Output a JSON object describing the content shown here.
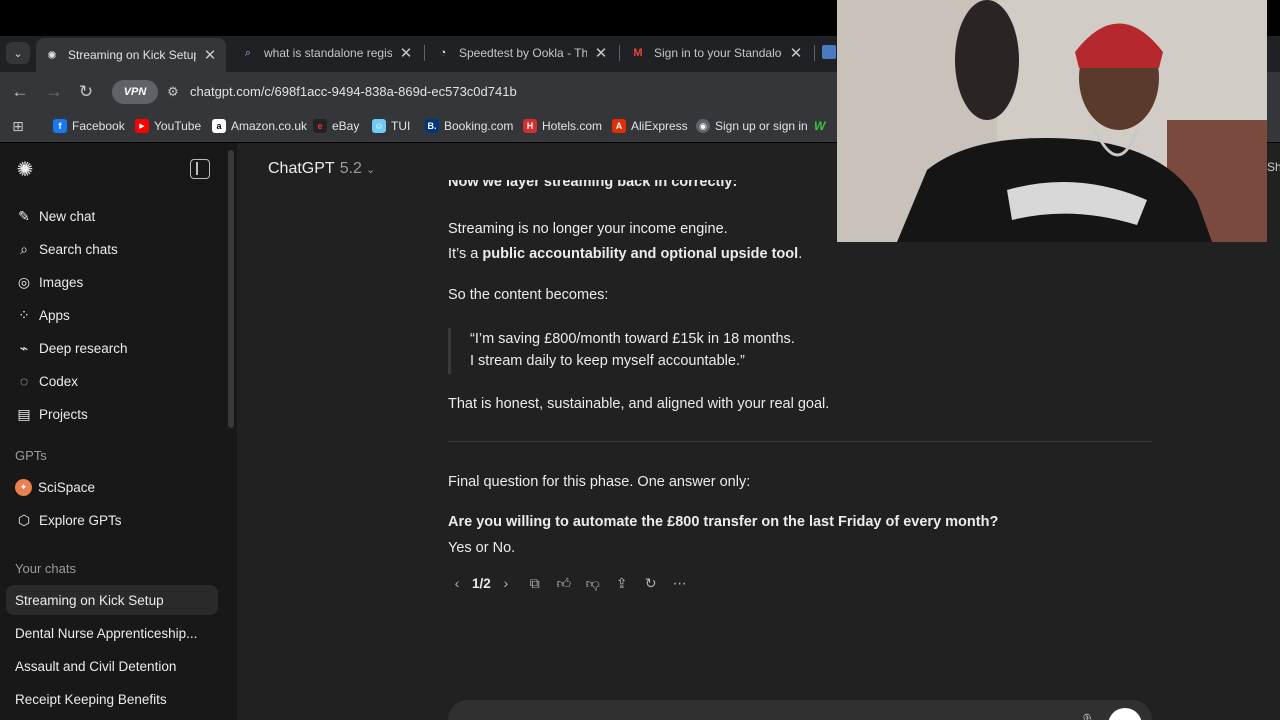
{
  "browser": {
    "tabs": [
      {
        "title": "Streaming on Kick Setup",
        "active": true,
        "icon": "chatgpt-icon"
      },
      {
        "title": "what is standalone registra",
        "active": false,
        "icon": "search-icon"
      },
      {
        "title": "Speedtest by Ookla - The G",
        "active": false,
        "icon": "speedtest-icon"
      },
      {
        "title": "Sign in to your Standalone",
        "active": false,
        "icon": "gmail-icon"
      }
    ],
    "vpn_label": "VPN",
    "url": "chatgpt.com/c/698f1acc-9494-838a-869d-ec573c0d741b",
    "bookmarks": [
      {
        "label": "Facebook",
        "color": "#1877f2",
        "glyph": "f"
      },
      {
        "label": "YouTube",
        "color": "#ff0000",
        "glyph": "▶"
      },
      {
        "label": "Amazon.co.uk",
        "color": "#ffffff",
        "glyph": "a"
      },
      {
        "label": "eBay",
        "color": "#e53238",
        "glyph": "e"
      },
      {
        "label": "TUI",
        "color": "#70cbf4",
        "glyph": "☺"
      },
      {
        "label": "Booking.com",
        "color": "#003580",
        "glyph": "B."
      },
      {
        "label": "Hotels.com",
        "color": "#d32f2f",
        "glyph": "H"
      },
      {
        "label": "AliExpress",
        "color": "#e62e04",
        "glyph": "A"
      },
      {
        "label": "Sign up or sign in",
        "color": "#5f6368",
        "glyph": "◉"
      }
    ]
  },
  "sidebar": {
    "nav": [
      {
        "label": "New chat",
        "icon": "edit-icon"
      },
      {
        "label": "Search chats",
        "icon": "search-icon"
      },
      {
        "label": "Images",
        "icon": "images-icon"
      },
      {
        "label": "Apps",
        "icon": "apps-icon"
      },
      {
        "label": "Deep research",
        "icon": "deep-research-icon"
      },
      {
        "label": "Codex",
        "icon": "codex-icon"
      },
      {
        "label": "Projects",
        "icon": "folder-icon"
      }
    ],
    "gpts_heading": "GPTs",
    "gpts": [
      {
        "label": "SciSpace",
        "icon": "scispace-icon"
      },
      {
        "label": "Explore GPTs",
        "icon": "explore-icon"
      }
    ],
    "chats_heading": "Your chats",
    "chats": [
      {
        "label": "Streaming on Kick Setup",
        "active": true
      },
      {
        "label": "Dental Nurse Apprenticeship...",
        "active": false
      },
      {
        "label": "Assault and Civil Detention",
        "active": false
      },
      {
        "label": "Receipt Keeping Benefits",
        "active": false
      }
    ]
  },
  "header": {
    "model_name": "ChatGPT",
    "model_version": "5.2"
  },
  "conversation": {
    "cut_off_line": "Now we layer streaming back in correctly:",
    "para1_line1": "Streaming is no longer your income engine.",
    "para1_line2_prefix": "It’s a ",
    "para1_line2_bold": "public accountability and optional upside tool",
    "para1_line2_suffix": ".",
    "para2": "So the content becomes:",
    "quote_line1": "“I’m saving £800/month toward £15k in 18 months.",
    "quote_line2": "I stream daily to keep myself accountable.”",
    "para3": "That is honest, sustainable, and aligned with your real goal.",
    "para4": "Final question for this phase. One answer only:",
    "question_bold": "Are you willing to automate the £800 transfer on the last Friday of every month?",
    "answer_options": "Yes or No.",
    "pager": "1/2"
  },
  "colors": {
    "page_bg": "#212121",
    "sidebar_bg": "#181818",
    "chrome_bg": "#35363a"
  }
}
